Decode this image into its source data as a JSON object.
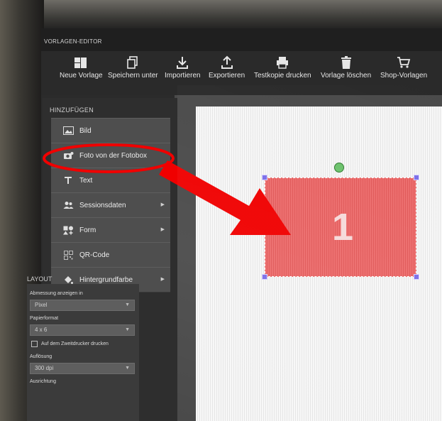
{
  "window": {
    "title": "VORLAGEN-EDITOR"
  },
  "toolbar": {
    "buttons": [
      {
        "label": "Neue Vorlage",
        "icon": "new-template-icon"
      },
      {
        "label": "Speichern unter",
        "icon": "copy-icon"
      },
      {
        "label": "Importieren",
        "icon": "download-icon"
      },
      {
        "label": "Exportieren",
        "icon": "upload-icon"
      },
      {
        "label": "Testkopie drucken",
        "icon": "printer-icon"
      },
      {
        "label": "Vorlage löschen",
        "icon": "trash-icon"
      },
      {
        "label": "Shop-Vorlagen",
        "icon": "cart-icon"
      }
    ]
  },
  "add_panel": {
    "heading": "HINZUFÜGEN",
    "items": [
      {
        "label": "Bild",
        "icon": "image-icon",
        "has_arrow": false
      },
      {
        "label": "Foto von der Fotobox",
        "icon": "camera-icon",
        "has_arrow": false
      },
      {
        "label": "Text",
        "icon": "text-icon",
        "has_arrow": false
      },
      {
        "label": "Sessionsdaten",
        "icon": "users-icon",
        "has_arrow": true
      },
      {
        "label": "Form",
        "icon": "shapes-icon",
        "has_arrow": true
      },
      {
        "label": "QR-Code",
        "icon": "qr-code-icon",
        "has_arrow": false
      },
      {
        "label": "Hintergrundfarbe",
        "icon": "paint-bucket-icon",
        "has_arrow": true
      }
    ],
    "arrow_glyph": "▶"
  },
  "layout_panel": {
    "heading": "LAYOUT",
    "dimension_label": "Abmessung anzeigen in",
    "dimension_value": "Pixel",
    "paper_label": "Papierformat",
    "paper_value": "4 x 6",
    "second_printer_label": "Auf dem Zweitdrucker drucken",
    "second_printer_checked": false,
    "resolution_label": "Auflösung",
    "resolution_value": "300 dpi",
    "orientation_label": "Ausrichtung",
    "caret_glyph": "▼"
  },
  "canvas": {
    "placeholder_number": "1",
    "placeholder_color": "#e96363",
    "handle_color": "#7b6ee8",
    "rotate_handle_color": "#6cc26c"
  },
  "annotation": {
    "color": "#f00000"
  }
}
